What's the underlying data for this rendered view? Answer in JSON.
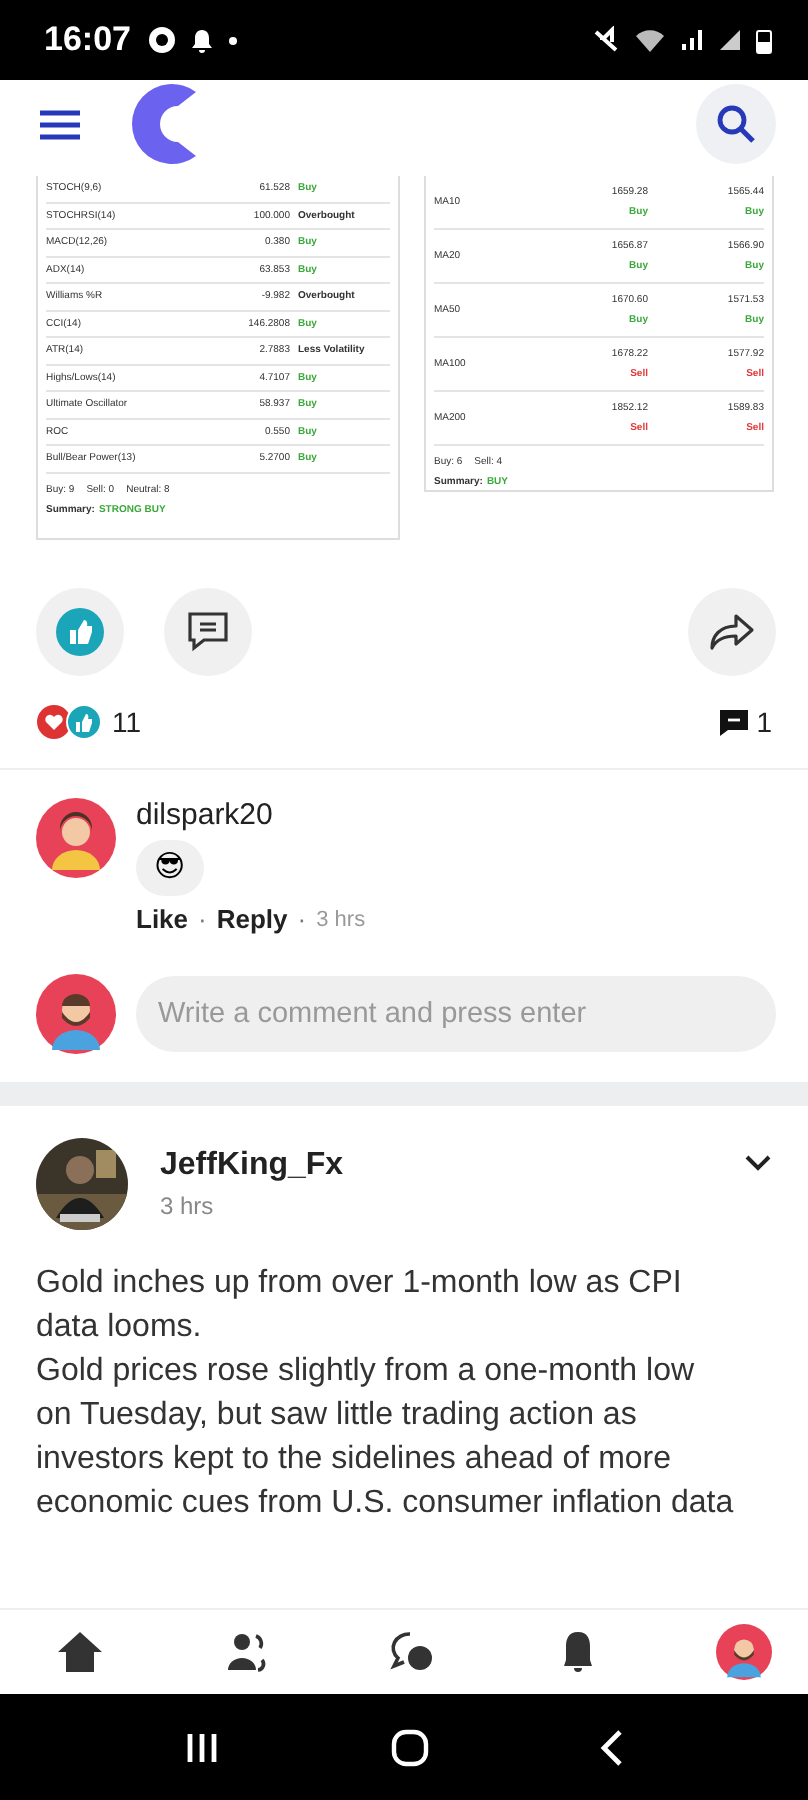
{
  "status_bar": {
    "time": "16:07"
  },
  "oscillators": [
    {
      "name": "STOCH(9,6)",
      "value": "61.528",
      "signal": "Buy",
      "kind": "buy"
    },
    {
      "name": "STOCHRSI(14)",
      "value": "100.000",
      "signal": "Overbought",
      "kind": "neutral"
    },
    {
      "name": "MACD(12,26)",
      "value": "0.380",
      "signal": "Buy",
      "kind": "buy"
    },
    {
      "name": "ADX(14)",
      "value": "63.853",
      "signal": "Buy",
      "kind": "buy"
    },
    {
      "name": "Williams %R",
      "value": "-9.982",
      "signal": "Overbought",
      "kind": "neutral"
    },
    {
      "name": "CCI(14)",
      "value": "146.2808",
      "signal": "Buy",
      "kind": "buy"
    },
    {
      "name": "ATR(14)",
      "value": "2.7883",
      "signal": "Less Volatility",
      "kind": "neutral"
    },
    {
      "name": "Highs/Lows(14)",
      "value": "4.7107",
      "signal": "Buy",
      "kind": "buy"
    },
    {
      "name": "Ultimate Oscillator",
      "value": "58.937",
      "signal": "Buy",
      "kind": "buy"
    },
    {
      "name": "ROC",
      "value": "0.550",
      "signal": "Buy",
      "kind": "buy"
    },
    {
      "name": "Bull/Bear Power(13)",
      "value": "5.2700",
      "signal": "Buy",
      "kind": "buy"
    }
  ],
  "oscillator_totals": [
    "Buy: 9",
    "Sell: 0",
    "Neutral: 8"
  ],
  "oscillator_summary": {
    "label": "Summary:",
    "value": "STRONG BUY",
    "kind": "buy"
  },
  "moving_averages": [
    {
      "name": "MA10",
      "cells": [
        {
          "value": "1659.28",
          "signal": "Buy",
          "kind": "buy"
        },
        {
          "value": "1565.44",
          "signal": "Buy",
          "kind": "buy"
        }
      ]
    },
    {
      "name": "MA20",
      "cells": [
        {
          "value": "1656.87",
          "signal": "Buy",
          "kind": "buy"
        },
        {
          "value": "1566.90",
          "signal": "Buy",
          "kind": "buy"
        }
      ]
    },
    {
      "name": "MA50",
      "cells": [
        {
          "value": "1670.60",
          "signal": "Buy",
          "kind": "buy"
        },
        {
          "value": "1571.53",
          "signal": "Buy",
          "kind": "buy"
        }
      ]
    },
    {
      "name": "MA100",
      "cells": [
        {
          "value": "1678.22",
          "signal": "Sell",
          "kind": "sell"
        },
        {
          "value": "1577.92",
          "signal": "Sell",
          "kind": "sell"
        }
      ]
    },
    {
      "name": "MA200",
      "cells": [
        {
          "value": "1852.12",
          "signal": "Sell",
          "kind": "sell"
        },
        {
          "value": "1589.83",
          "signal": "Sell",
          "kind": "sell"
        }
      ]
    }
  ],
  "ma_totals": [
    "Buy: 6",
    "Sell: 4"
  ],
  "ma_summary": {
    "label": "Summary:",
    "value": "BUY",
    "kind": "buy"
  },
  "post_actions": {
    "liked": true
  },
  "reactions": {
    "count": "11",
    "comments": "1"
  },
  "comments": [
    {
      "author": "dilspark20",
      "emoji": "😎",
      "actions": [
        "Like",
        "Reply"
      ],
      "separator": "·",
      "time": "3 hrs"
    }
  ],
  "comment_input": {
    "placeholder": "Write a comment and press enter"
  },
  "next_post": {
    "author": "JeffKing_Fx",
    "time": "3 hrs",
    "body": [
      "Gold inches up from over 1-month low as CPI data looms.",
      "Gold prices rose slightly from a one-month low on Tuesday, but saw little trading action as investors kept to the sidelines ahead of more economic cues from U.S. consumer inflation data"
    ]
  }
}
